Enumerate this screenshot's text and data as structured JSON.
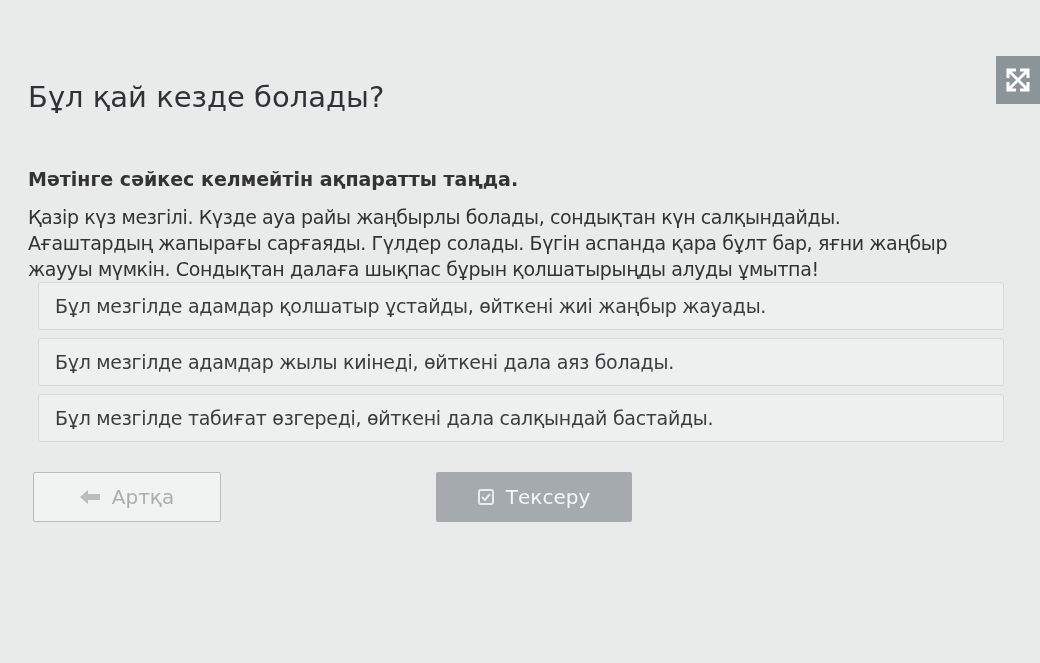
{
  "title": "Бұл қай кезде болады?",
  "instruction": "Мәтінге сәйкес келмейтін ақпаратты таңда.",
  "passage": "Қазір күз мезгілі. Күзде ауа райы жаңбырлы болады, сондықтан күн салқындайды. Ағаштардың жапырағы сарғаяды. Гүлдер солады. Бүгін аспанда қара бұлт бар, яғни жаңбыр жаууы мүмкін. Сондықтан далаға шықпас бұрын қолшатырыңды алуды ұмытпа!",
  "options": [
    {
      "label": "Бұл мезгілде адамдар қолшатыр ұстайды, өйткені жиі жаңбыр жауады.",
      "selected": false
    },
    {
      "label": "Бұл мезгілде адамдар жылы киінеді, өйткені дала аяз болады.",
      "selected": false
    },
    {
      "label": "Бұл мезгілде табиғат өзгереді, өйткені дала салқындай бастайды.",
      "selected": false
    }
  ],
  "buttons": [
    {
      "kind": "back",
      "label": "Артқа",
      "disabled": false
    },
    {
      "kind": "check",
      "label": "Тексеру",
      "disabled": true
    }
  ]
}
